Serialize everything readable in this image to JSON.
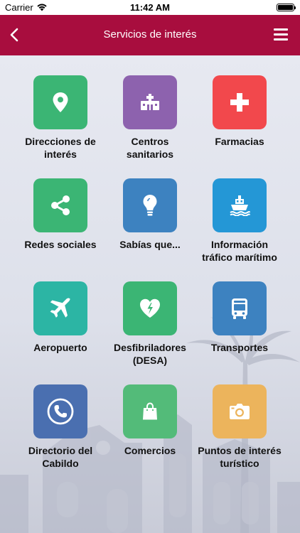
{
  "status_bar": {
    "carrier": "Carrier",
    "time": "11:42 AM",
    "battery_level": 1.0
  },
  "nav": {
    "title": "Servicios de interés",
    "back_icon": "chevron-left-icon",
    "menu_icon": "hamburger-menu-icon",
    "color": "#a80d3e"
  },
  "services": [
    {
      "label": "Direcciones de interés",
      "icon": "location-pin-icon",
      "color": "#3bb574"
    },
    {
      "label": "Centros sanitarios",
      "icon": "hospital-icon",
      "color": "#8d62ae"
    },
    {
      "label": "Farmacias",
      "icon": "medical-cross-icon",
      "color": "#f2484c"
    },
    {
      "label": "Redes sociales",
      "icon": "share-icon",
      "color": "#3bb574"
    },
    {
      "label": "Sabías que...",
      "icon": "lightbulb-icon",
      "color": "#3d82c0"
    },
    {
      "label": "Información tráfico marítimo",
      "icon": "ship-icon",
      "color": "#2497d6"
    },
    {
      "label": "Aeropuerto",
      "icon": "airplane-icon",
      "color": "#2cb5a4"
    },
    {
      "label": "Desfibriladores (DESA)",
      "icon": "heart-defibrillator-icon",
      "color": "#3bb574"
    },
    {
      "label": "Transportes",
      "icon": "bus-icon",
      "color": "#3d82c0"
    },
    {
      "label": "Directorio del Cabildo",
      "icon": "phone-icon",
      "color": "#4a6fb0"
    },
    {
      "label": "Comercios",
      "icon": "shopping-bag-icon",
      "color": "#53bb79"
    },
    {
      "label": "Puntos de interés turístico",
      "icon": "camera-icon",
      "color": "#ecb45c"
    }
  ]
}
